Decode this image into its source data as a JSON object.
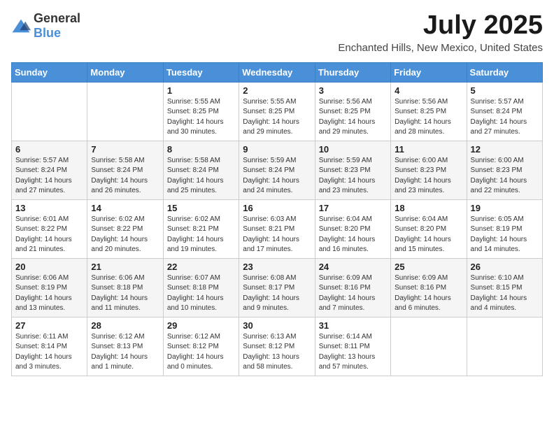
{
  "logo": {
    "general": "General",
    "blue": "Blue"
  },
  "title": "July 2025",
  "location": "Enchanted Hills, New Mexico, United States",
  "weekdays": [
    "Sunday",
    "Monday",
    "Tuesday",
    "Wednesday",
    "Thursday",
    "Friday",
    "Saturday"
  ],
  "weeks": [
    [
      {
        "day": "",
        "info": ""
      },
      {
        "day": "",
        "info": ""
      },
      {
        "day": "1",
        "sunrise": "5:55 AM",
        "sunset": "8:25 PM",
        "daylight": "14 hours and 30 minutes."
      },
      {
        "day": "2",
        "sunrise": "5:55 AM",
        "sunset": "8:25 PM",
        "daylight": "14 hours and 29 minutes."
      },
      {
        "day": "3",
        "sunrise": "5:56 AM",
        "sunset": "8:25 PM",
        "daylight": "14 hours and 29 minutes."
      },
      {
        "day": "4",
        "sunrise": "5:56 AM",
        "sunset": "8:25 PM",
        "daylight": "14 hours and 28 minutes."
      },
      {
        "day": "5",
        "sunrise": "5:57 AM",
        "sunset": "8:24 PM",
        "daylight": "14 hours and 27 minutes."
      }
    ],
    [
      {
        "day": "6",
        "sunrise": "5:57 AM",
        "sunset": "8:24 PM",
        "daylight": "14 hours and 27 minutes."
      },
      {
        "day": "7",
        "sunrise": "5:58 AM",
        "sunset": "8:24 PM",
        "daylight": "14 hours and 26 minutes."
      },
      {
        "day": "8",
        "sunrise": "5:58 AM",
        "sunset": "8:24 PM",
        "daylight": "14 hours and 25 minutes."
      },
      {
        "day": "9",
        "sunrise": "5:59 AM",
        "sunset": "8:24 PM",
        "daylight": "14 hours and 24 minutes."
      },
      {
        "day": "10",
        "sunrise": "5:59 AM",
        "sunset": "8:23 PM",
        "daylight": "14 hours and 23 minutes."
      },
      {
        "day": "11",
        "sunrise": "6:00 AM",
        "sunset": "8:23 PM",
        "daylight": "14 hours and 23 minutes."
      },
      {
        "day": "12",
        "sunrise": "6:00 AM",
        "sunset": "8:23 PM",
        "daylight": "14 hours and 22 minutes."
      }
    ],
    [
      {
        "day": "13",
        "sunrise": "6:01 AM",
        "sunset": "8:22 PM",
        "daylight": "14 hours and 21 minutes."
      },
      {
        "day": "14",
        "sunrise": "6:02 AM",
        "sunset": "8:22 PM",
        "daylight": "14 hours and 20 minutes."
      },
      {
        "day": "15",
        "sunrise": "6:02 AM",
        "sunset": "8:21 PM",
        "daylight": "14 hours and 19 minutes."
      },
      {
        "day": "16",
        "sunrise": "6:03 AM",
        "sunset": "8:21 PM",
        "daylight": "14 hours and 17 minutes."
      },
      {
        "day": "17",
        "sunrise": "6:04 AM",
        "sunset": "8:20 PM",
        "daylight": "14 hours and 16 minutes."
      },
      {
        "day": "18",
        "sunrise": "6:04 AM",
        "sunset": "8:20 PM",
        "daylight": "14 hours and 15 minutes."
      },
      {
        "day": "19",
        "sunrise": "6:05 AM",
        "sunset": "8:19 PM",
        "daylight": "14 hours and 14 minutes."
      }
    ],
    [
      {
        "day": "20",
        "sunrise": "6:06 AM",
        "sunset": "8:19 PM",
        "daylight": "14 hours and 13 minutes."
      },
      {
        "day": "21",
        "sunrise": "6:06 AM",
        "sunset": "8:18 PM",
        "daylight": "14 hours and 11 minutes."
      },
      {
        "day": "22",
        "sunrise": "6:07 AM",
        "sunset": "8:18 PM",
        "daylight": "14 hours and 10 minutes."
      },
      {
        "day": "23",
        "sunrise": "6:08 AM",
        "sunset": "8:17 PM",
        "daylight": "14 hours and 9 minutes."
      },
      {
        "day": "24",
        "sunrise": "6:09 AM",
        "sunset": "8:16 PM",
        "daylight": "14 hours and 7 minutes."
      },
      {
        "day": "25",
        "sunrise": "6:09 AM",
        "sunset": "8:16 PM",
        "daylight": "14 hours and 6 minutes."
      },
      {
        "day": "26",
        "sunrise": "6:10 AM",
        "sunset": "8:15 PM",
        "daylight": "14 hours and 4 minutes."
      }
    ],
    [
      {
        "day": "27",
        "sunrise": "6:11 AM",
        "sunset": "8:14 PM",
        "daylight": "14 hours and 3 minutes."
      },
      {
        "day": "28",
        "sunrise": "6:12 AM",
        "sunset": "8:13 PM",
        "daylight": "14 hours and 1 minute."
      },
      {
        "day": "29",
        "sunrise": "6:12 AM",
        "sunset": "8:12 PM",
        "daylight": "14 hours and 0 minutes."
      },
      {
        "day": "30",
        "sunrise": "6:13 AM",
        "sunset": "8:12 PM",
        "daylight": "13 hours and 58 minutes."
      },
      {
        "day": "31",
        "sunrise": "6:14 AM",
        "sunset": "8:11 PM",
        "daylight": "13 hours and 57 minutes."
      },
      {
        "day": "",
        "info": ""
      },
      {
        "day": "",
        "info": ""
      }
    ]
  ],
  "labels": {
    "sunrise": "Sunrise:",
    "sunset": "Sunset:",
    "daylight": "Daylight:"
  },
  "accent_color": "#4a90d9"
}
